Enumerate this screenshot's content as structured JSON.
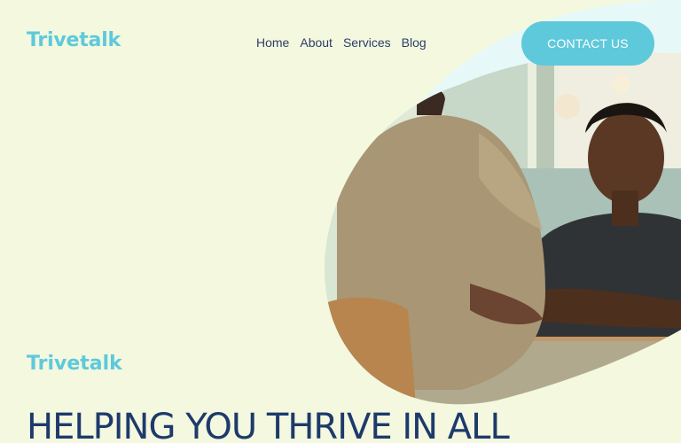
{
  "header": {
    "logo": "Trivetalk",
    "nav": [
      {
        "label": "Home"
      },
      {
        "label": "About"
      },
      {
        "label": "Services"
      },
      {
        "label": "Blog"
      }
    ],
    "cta_label": "CONTACT US"
  },
  "hero": {
    "brand": "Trivetalk",
    "heading": "HELPING YOU THRIVE IN ALL"
  },
  "colors": {
    "background": "#f3f8df",
    "accent": "#5ec9db",
    "heading": "#1e3a6b",
    "nav_text": "#2d3e66"
  },
  "icons": {
    "hero_photo": "counseling-session-photo"
  }
}
